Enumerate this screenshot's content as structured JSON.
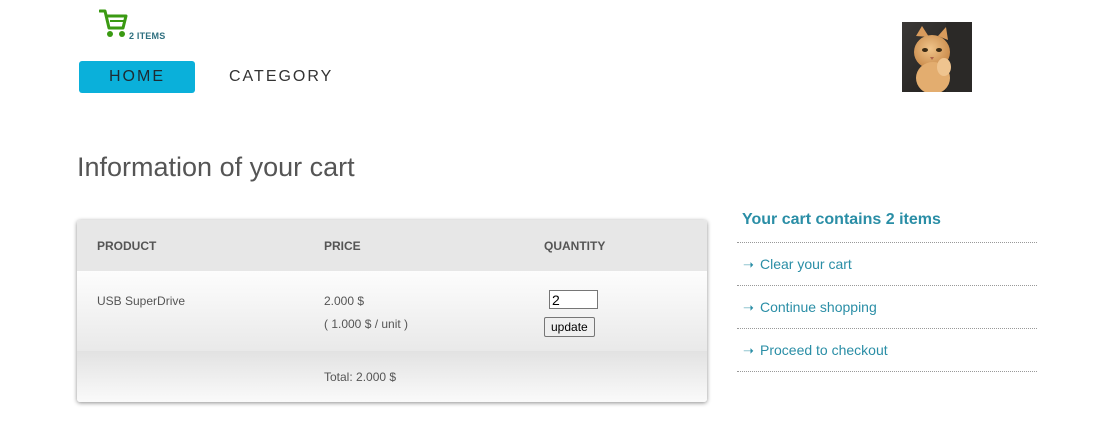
{
  "header": {
    "cart_count": "2 ITEMS",
    "cart_icon": "shopping-cart-icon",
    "cart_icon_color": "#3a9a12",
    "nav": {
      "home_label": "HOME",
      "category_label": "CATEGORY",
      "active_color": "#0ab0da"
    },
    "avatar": "user-avatar-cat-photo"
  },
  "main": {
    "title": "Information of your cart",
    "table": {
      "headers": {
        "product": "PRODUCT",
        "price": "PRICE",
        "quantity": "QUANTITY"
      },
      "items": [
        {
          "product": "USB SuperDrive",
          "price": "2.000 $",
          "unit_price": "( 1.000 $ / unit )",
          "quantity": "2",
          "update_label": "update"
        }
      ],
      "total": "Total: 2.000 $"
    }
  },
  "sidebar": {
    "title": "Your cart contains 2 items",
    "arrow_icon": "right-arrow-icon",
    "links": [
      {
        "label": "Clear your cart"
      },
      {
        "label": "Continue shopping"
      },
      {
        "label": "Proceed to checkout"
      }
    ],
    "link_color": "#2a8ea6"
  }
}
